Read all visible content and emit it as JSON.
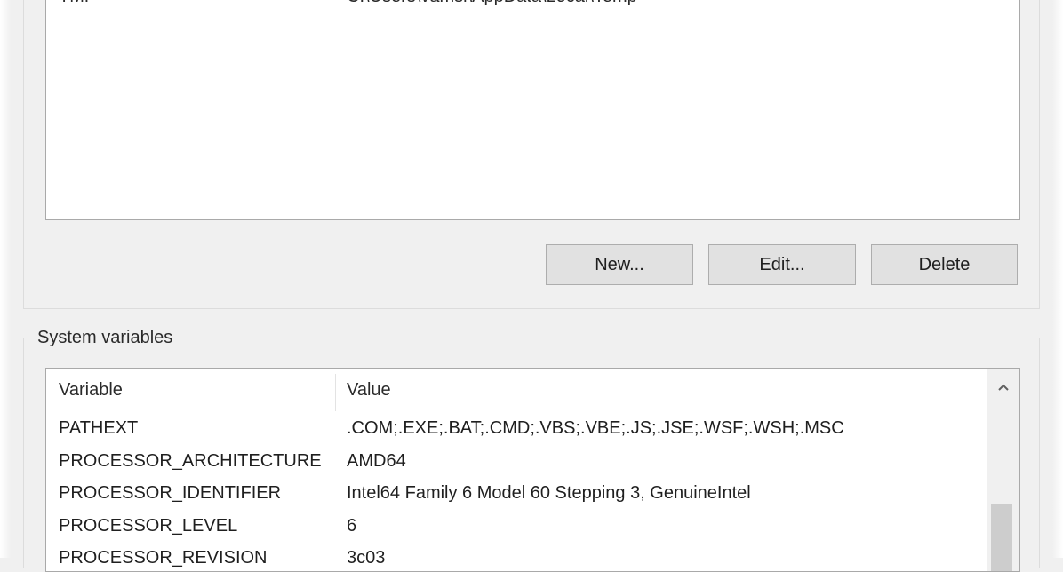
{
  "user_variables": {
    "rows": [
      {
        "variable": "TMP",
        "value": "C:\\Users\\vamsi\\AppData\\Local\\Temp"
      }
    ],
    "buttons": {
      "new_label": "New...",
      "edit_label": "Edit...",
      "delete_label": "Delete"
    }
  },
  "system_variables": {
    "group_title": "System variables",
    "columns": {
      "variable": "Variable",
      "value": "Value"
    },
    "rows": [
      {
        "variable": "PATHEXT",
        "value": ".COM;.EXE;.BAT;.CMD;.VBS;.VBE;.JS;.JSE;.WSF;.WSH;.MSC"
      },
      {
        "variable": "PROCESSOR_ARCHITECTURE",
        "value": "AMD64"
      },
      {
        "variable": "PROCESSOR_IDENTIFIER",
        "value": "Intel64 Family 6 Model 60 Stepping 3, GenuineIntel"
      },
      {
        "variable": "PROCESSOR_LEVEL",
        "value": "6"
      },
      {
        "variable": "PROCESSOR_REVISION",
        "value": "3c03"
      }
    ],
    "scrollbar_icon": "chevron-up-icon"
  }
}
